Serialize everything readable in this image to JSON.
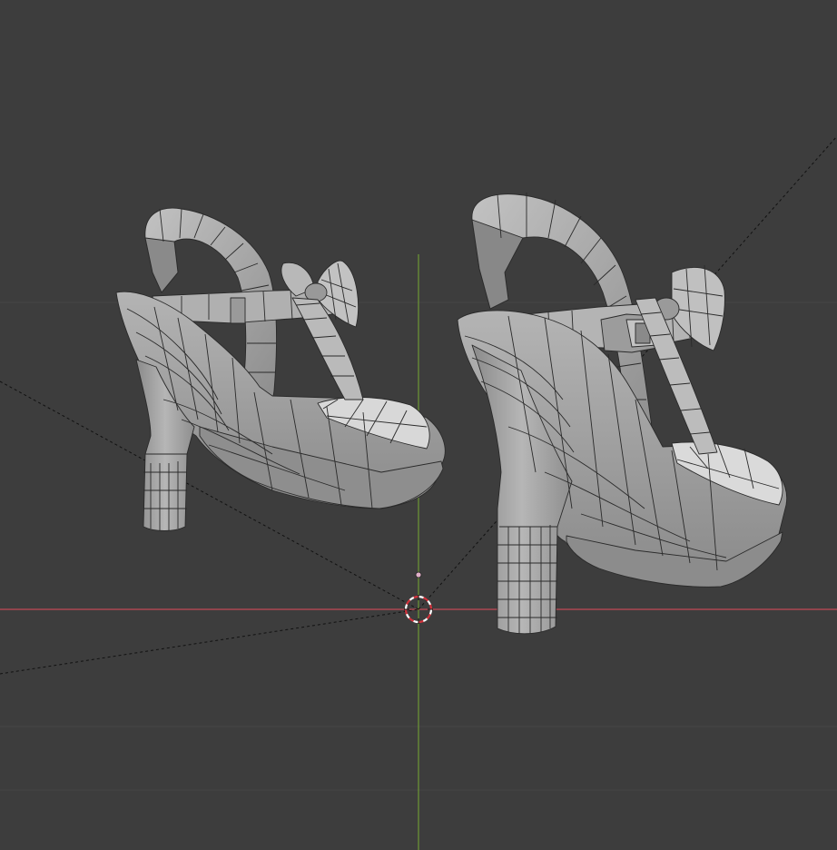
{
  "viewport": {
    "background": "#3d3d3d",
    "grid_line_color": "#474747",
    "x_axis_color": "#d04a55",
    "y_axis_color": "#78a23a",
    "mesh_fill": "#a8a8a8",
    "mesh_shadow": "#7e7e7e",
    "mesh_light": "#c8c8c8",
    "mesh_wire": "#2a2a2a",
    "cursor_icon": "3d-cursor-icon",
    "objects": [
      {
        "name": "left-shoe",
        "type": "mesh"
      },
      {
        "name": "right-shoe",
        "type": "mesh"
      },
      {
        "name": "camera-guide",
        "type": "dashed-lines"
      }
    ]
  }
}
